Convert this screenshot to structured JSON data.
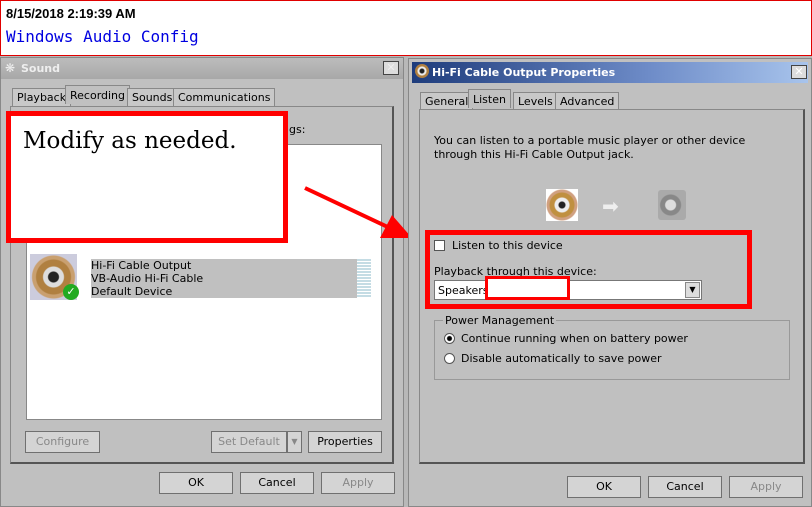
{
  "banner": {
    "timestamp": "8/15/2018 2:19:39 AM",
    "title": "Windows Audio Config"
  },
  "sound": {
    "title": "Sound",
    "tabs": [
      "Playback",
      "Recording",
      "Sounds",
      "Communications"
    ],
    "active_tab": "Recording",
    "hidden_label_tail": "gs:",
    "device": {
      "name": "Hi-Fi Cable Output",
      "driver": "VB-Audio Hi-Fi Cable",
      "status": "Default Device"
    },
    "buttons": {
      "configure": "Configure",
      "set_default": "Set Default",
      "properties": "Properties",
      "ok": "OK",
      "cancel": "Cancel",
      "apply": "Apply"
    }
  },
  "callout": {
    "text": "Modify as needed.",
    "color": "#ff0000"
  },
  "props": {
    "title": "Hi-Fi Cable Output Properties",
    "tabs": [
      "General",
      "Listen",
      "Levels",
      "Advanced"
    ],
    "active_tab": "Listen",
    "description": "You can listen to a portable music player or other device through this Hi-Fi Cable Output jack.",
    "listen_label": "Listen to this device",
    "listen_checked": false,
    "playback_label": "Playback through this device:",
    "playback_value": "Speakers",
    "power": {
      "legend": "Power Management",
      "options": [
        "Continue running when on battery power",
        "Disable automatically to save power"
      ],
      "selected": 0
    },
    "buttons": {
      "ok": "OK",
      "cancel": "Cancel",
      "apply": "Apply"
    }
  }
}
